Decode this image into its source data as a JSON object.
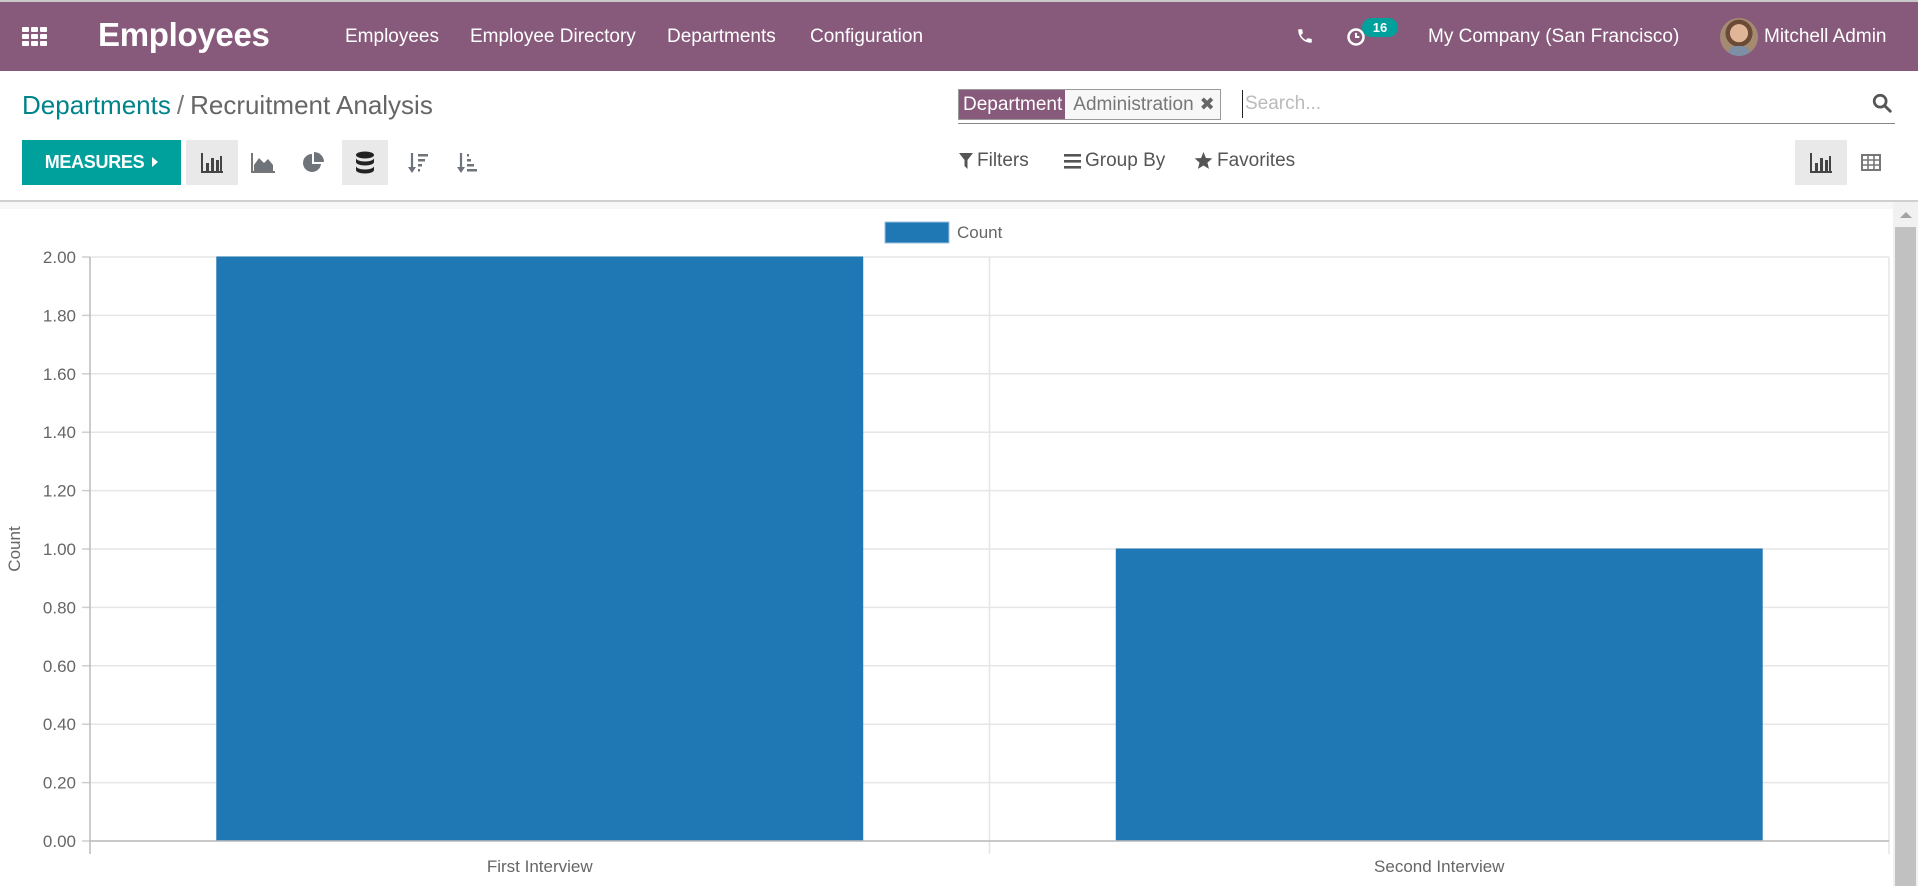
{
  "navbar": {
    "apps_icon": "apps-grid-icon",
    "brand": "Employees",
    "menu": [
      "Employees",
      "Employee Directory",
      "Departments",
      "Configuration"
    ],
    "phone_icon": "phone-icon",
    "activity_icon": "clock-icon",
    "activity_count": "16",
    "company": "My Company (San Francisco)",
    "user": "Mitchell Admin",
    "color": "#875A7B"
  },
  "breadcrumb": {
    "parent": "Departments",
    "separator": "/",
    "current": "Recruitment Analysis"
  },
  "search": {
    "facet_label": "Department",
    "facet_value": "Administration",
    "facet_remove_icon": "close-icon",
    "placeholder": "Search...",
    "value": ""
  },
  "toolbar": {
    "measures_label": "MEASURES",
    "accent": "#00A09D",
    "chart_modes": [
      {
        "name": "bar-chart",
        "active": true
      },
      {
        "name": "line-chart",
        "active": false
      },
      {
        "name": "pie-chart",
        "active": false
      },
      {
        "name": "stacked",
        "active": true
      },
      {
        "name": "sort-descending",
        "active": false
      },
      {
        "name": "sort-ascending",
        "active": false
      }
    ]
  },
  "search_options": {
    "filters": "Filters",
    "group_by": "Group By",
    "favorites": "Favorites"
  },
  "views": {
    "graph_active": true,
    "pivot_active": false
  },
  "chart_data": {
    "type": "bar",
    "categories": [
      "First Interview",
      "Second Interview"
    ],
    "series": [
      {
        "name": "Count",
        "values": [
          2,
          1
        ],
        "color": "#1f77b4"
      }
    ],
    "title": "",
    "xlabel": "",
    "ylabel": "Count",
    "ylim": [
      0,
      2
    ],
    "yticks": [
      "0.00",
      "0.20",
      "0.40",
      "0.60",
      "0.80",
      "1.00",
      "1.20",
      "1.40",
      "1.60",
      "1.80",
      "2.00"
    ],
    "grid": true,
    "legend": "top-center"
  }
}
